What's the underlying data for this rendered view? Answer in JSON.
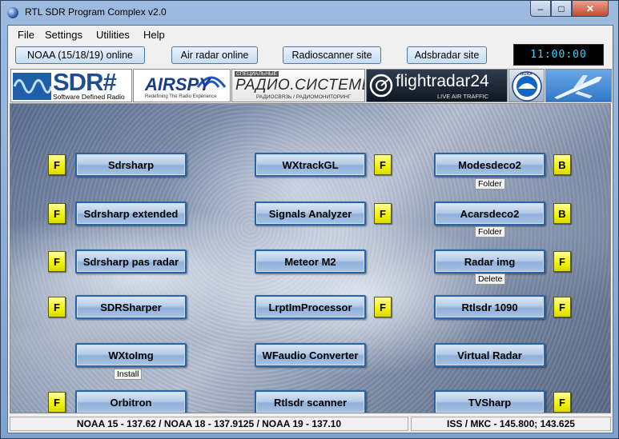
{
  "window": {
    "title": "RTL SDR Program Complex v2.0",
    "min_glyph": "–",
    "max_glyph": "□",
    "close_glyph": "✕"
  },
  "menu": [
    "File",
    "Settings",
    "Utilities",
    "Help"
  ],
  "toolbar": {
    "noaa": "NOAA (15/18/19) online",
    "air_radar": "Air radar online",
    "radioscanner": "Radioscanner site",
    "adsbradar": "Adsbradar site",
    "clock": "11:00:00"
  },
  "banners": {
    "sdrsharp": {
      "big": "SDR#",
      "small": "Software Defined Radio"
    },
    "airspy": {
      "big": "AIRSPY",
      "small": "Redefining The Radio Experience"
    },
    "radiosystems": {
      "tag": "СПЕЦИАЛЬНЫЕ",
      "big": "РАДИО.СИСТЕМЫ",
      "small": "РАДИОСВЯЗЬ / РАДИОМОНИТОРИНГ"
    },
    "flightradar": {
      "big": "flightradar24",
      "small": "LIVE AIR TRAFFIC"
    },
    "noaa_logo": "NOAA"
  },
  "apps": {
    "col1": [
      {
        "label": "Sdrsharp",
        "flag": "F"
      },
      {
        "label": "Sdrsharp extended",
        "flag": "F"
      },
      {
        "label": "Sdrsharp pas radar",
        "flag": "F"
      },
      {
        "label": "SDRSharper",
        "flag": "F"
      },
      {
        "label": "WXtoImg",
        "extra": "Install"
      },
      {
        "label": "Orbitron",
        "flag": "F"
      }
    ],
    "col2": [
      {
        "label": "WXtrackGL",
        "flag": "F"
      },
      {
        "label": "Signals Analyzer",
        "flag": "F"
      },
      {
        "label": "Meteor M2"
      },
      {
        "label": "LrptImProcessor",
        "flag": "F"
      },
      {
        "label": "WFaudio Converter"
      },
      {
        "label": "Rtlsdr scanner"
      }
    ],
    "col3": [
      {
        "label": "Modesdeco2",
        "flag": "B",
        "extra": "Folder"
      },
      {
        "label": "Acarsdeco2",
        "flag": "B",
        "extra": "Folder"
      },
      {
        "label": "Radar img",
        "flag": "F",
        "extra": "Delete"
      },
      {
        "label": "Rtlsdr 1090",
        "flag": "F"
      },
      {
        "label": "Virtual Radar"
      },
      {
        "label": "TVSharp",
        "flag": "F"
      }
    ]
  },
  "status": {
    "left": "NOAA 15 - 137.62 / NOAA 18 - 137.9125 / NOAA 19 - 137.10",
    "right": "ISS / МКС - 145.800; 143.625"
  }
}
